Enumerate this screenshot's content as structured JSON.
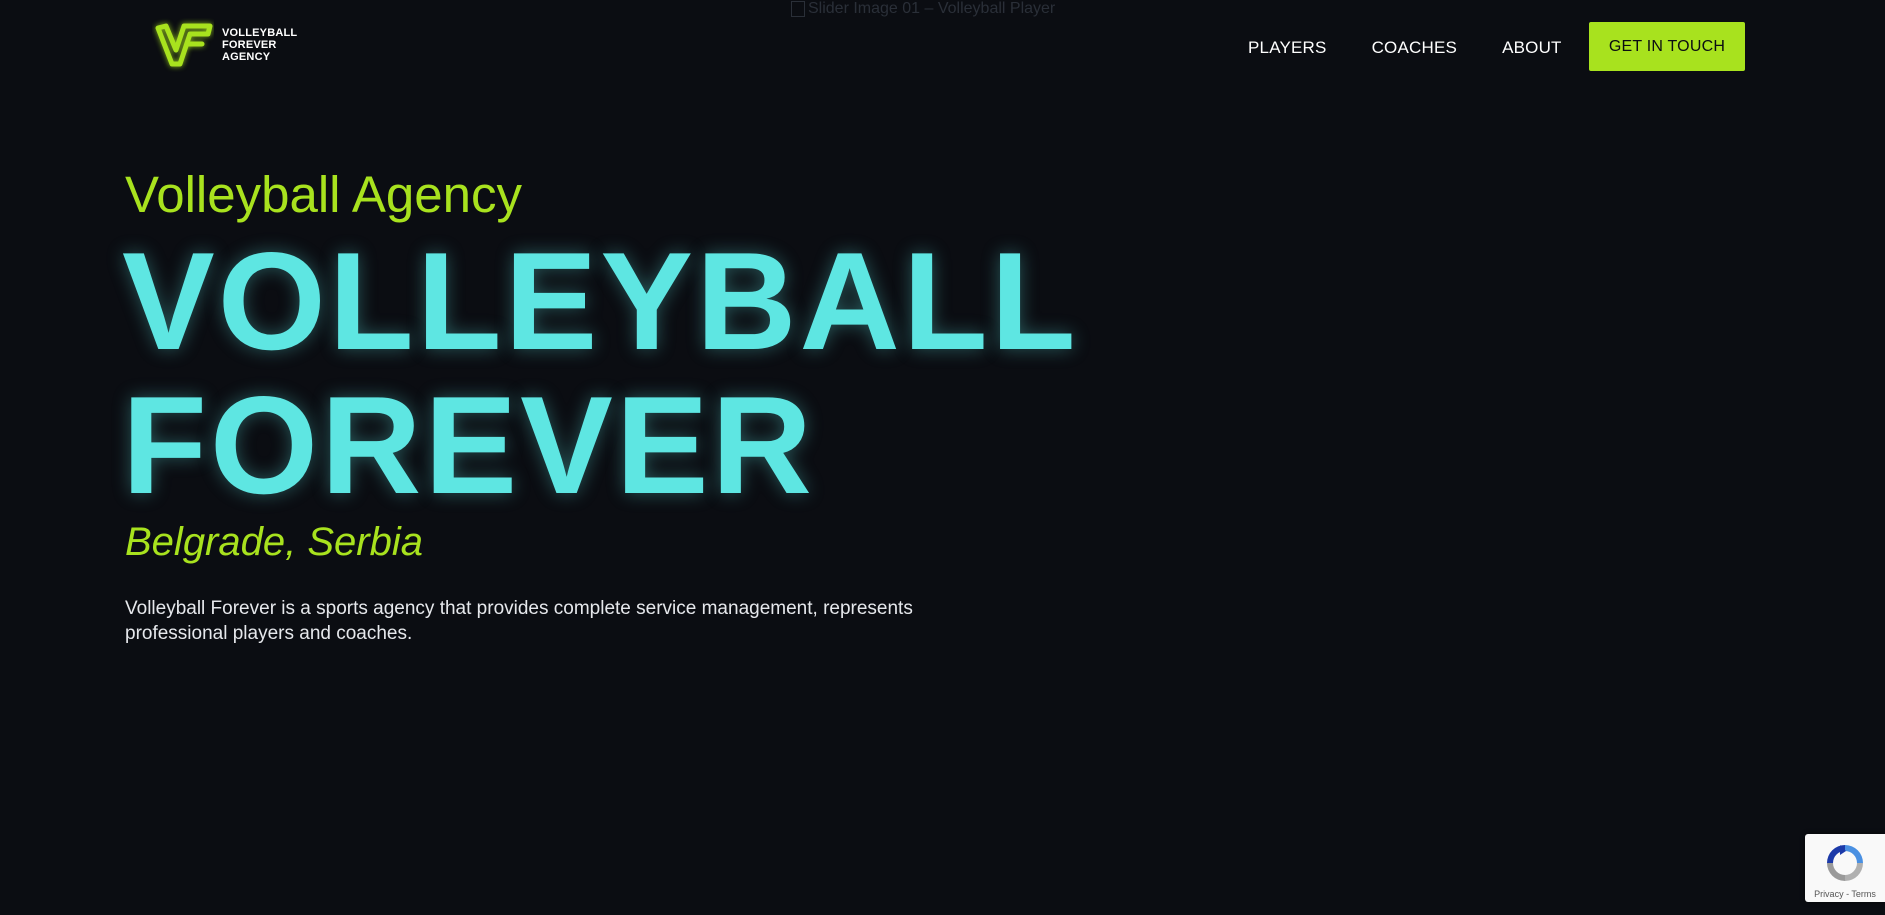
{
  "header": {
    "logo": {
      "icon": "vf-logo-icon",
      "lines": [
        "VOLLEYBALL",
        "FOREVER",
        "AGENCY"
      ]
    },
    "broken_image_alt": "Slider Image 01 – Volleyball Player",
    "nav": [
      {
        "label": "PLAYERS"
      },
      {
        "label": "COACHES"
      },
      {
        "label": "ABOUT"
      }
    ],
    "cta_label": "GET IN TOUCH"
  },
  "hero": {
    "eyebrow": "Volleyball Agency",
    "headline_line1": "VOLLEYBALL",
    "headline_line2": "FOREVER",
    "location": "Belgrade, Serbia",
    "description": "Volleyball Forever is a sports agency that provides complete service management, represents professional players and coaches."
  },
  "recaptcha": {
    "icon": "recaptcha-icon",
    "privacy": "Privacy",
    "separator": " - ",
    "terms": "Terms"
  },
  "colors": {
    "background": "#0b0d12",
    "accent_green": "#a8e21e",
    "accent_cyan": "#5ee6e2",
    "text": "#ffffff"
  }
}
